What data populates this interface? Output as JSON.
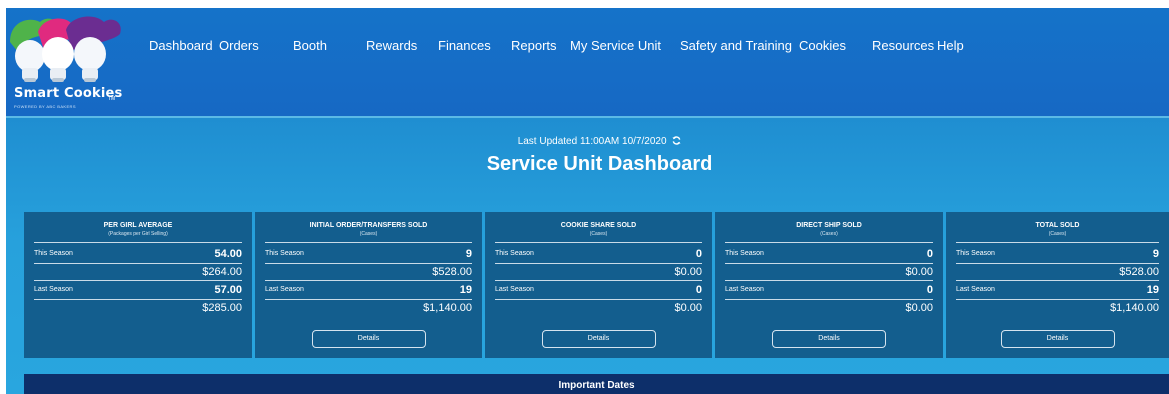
{
  "logo": {
    "text": "Smart Cookies",
    "tm": "TM",
    "tagline": "POWERED BY ABC BAKERS",
    "colors": [
      "#4fb34a",
      "#e02a7f",
      "#6b2d91"
    ]
  },
  "nav": {
    "items": [
      {
        "label": "Dashboard"
      },
      {
        "label": "Orders"
      },
      {
        "label": "Booth"
      },
      {
        "label": "Rewards"
      },
      {
        "label": "Finances"
      },
      {
        "label": "Reports"
      },
      {
        "label": "My Service Unit"
      },
      {
        "label": "Safety and Training"
      },
      {
        "label": "Cookies"
      },
      {
        "label": "Resources"
      },
      {
        "label": "Help"
      }
    ]
  },
  "dashboard": {
    "last_updated": "Last Updated 11:00AM 10/7/2020",
    "refresh_icon": "refresh-icon",
    "title": "Service Unit Dashboard"
  },
  "cards": [
    {
      "title": "PER GIRL AVERAGE",
      "subtitle": "(Packages per Girl Selling)",
      "this_label": "This Season",
      "this_value": "54.00",
      "this_money": "$264.00",
      "last_label": "Last Season",
      "last_value": "57.00",
      "last_money": "$285.00",
      "details": ""
    },
    {
      "title": "INITIAL ORDER/TRANSFERS SOLD",
      "subtitle": "(Cases)",
      "this_label": "This Season",
      "this_value": "9",
      "this_money": "$528.00",
      "last_label": "Last Season",
      "last_value": "19",
      "last_money": "$1,140.00",
      "details": "Details"
    },
    {
      "title": "COOKIE SHARE SOLD",
      "subtitle": "(Cases)",
      "this_label": "This Season",
      "this_value": "0",
      "this_money": "$0.00",
      "last_label": "Last Season",
      "last_value": "0",
      "last_money": "$0.00",
      "details": "Details"
    },
    {
      "title": "DIRECT SHIP SOLD",
      "subtitle": "(Cases)",
      "this_label": "This Season",
      "this_value": "0",
      "this_money": "$0.00",
      "last_label": "Last Season",
      "last_value": "0",
      "last_money": "$0.00",
      "details": "Details"
    },
    {
      "title": "TOTAL SOLD",
      "subtitle": "(Cases)",
      "this_label": "This Season",
      "this_value": "9",
      "this_money": "$528.00",
      "last_label": "Last Season",
      "last_value": "19",
      "last_money": "$1,140.00",
      "details": "Details"
    }
  ],
  "important_dates": {
    "title": "Important Dates"
  },
  "colors": {
    "header": "#1668c4",
    "band": "#27a1dc",
    "card": "#135e8e",
    "important_bar": "#0d2f6a"
  }
}
